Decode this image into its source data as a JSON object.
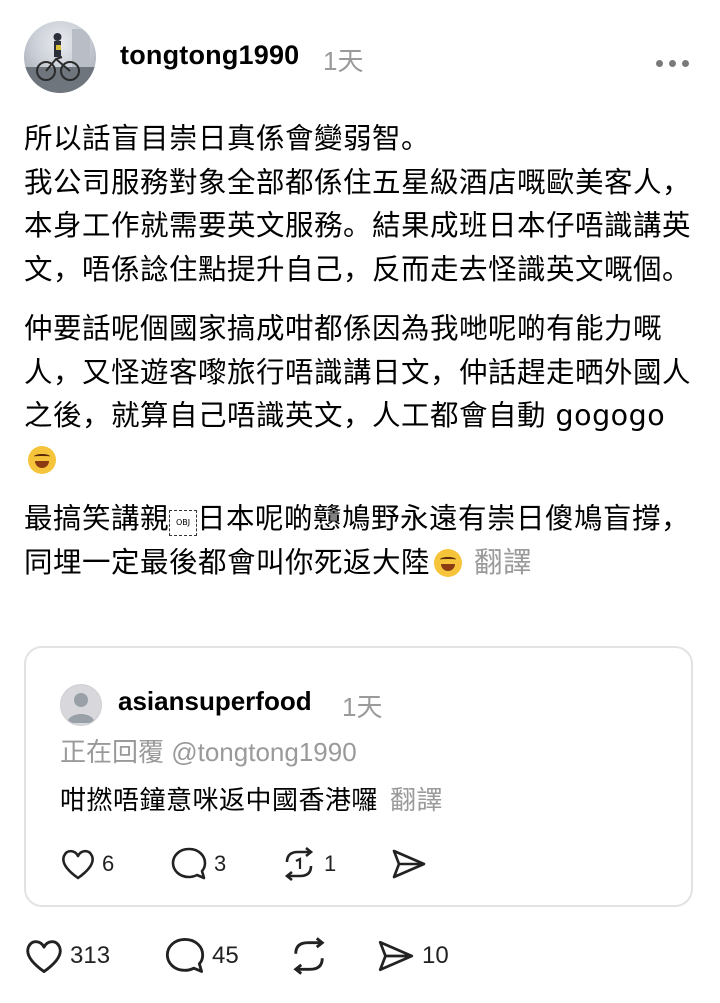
{
  "post": {
    "username": "tongtong1990",
    "time": "1天",
    "paragraphs": {
      "p1": "所以話盲目崇日真係會變弱智。\n我公司服務對象全部都係住五星級酒店嘅歐美客人，本身工作就需要英文服務。結果成班日本仔唔識講英文，唔係諗住點提升自己，反而走去怪識英文嘅個。",
      "p2": "仲要話呢個國家搞成咁都係因為我哋呢啲有能力嘅人，又怪遊客嚟旅行唔識講日文，仲話趕走晒外國人之後，就算自己唔識英文，人工都會自動 gogogo",
      "p3a": "最搞笑講親",
      "p3b": "日本呢啲戇鳩野永遠有崇日傻鳩盲撐，同埋一定最後都會叫你死返大陸",
      "translate": "翻譯"
    },
    "obj_glyph": "OBJ",
    "counts": {
      "likes": "313",
      "comments": "45",
      "shares": "10"
    }
  },
  "reply": {
    "username": "asiansuperfood",
    "time": "1天",
    "replying_to": "正在回覆 @tongtong1990",
    "text": "咁撚唔鐘意咪返中國香港囉",
    "translate": "翻譯",
    "counts": {
      "likes": "6",
      "comments": "3",
      "reposts": "1"
    }
  },
  "icons": [
    "more-icon",
    "heart-icon",
    "comment-icon",
    "repost-icon",
    "send-icon",
    "laughing-emoji-icon"
  ]
}
